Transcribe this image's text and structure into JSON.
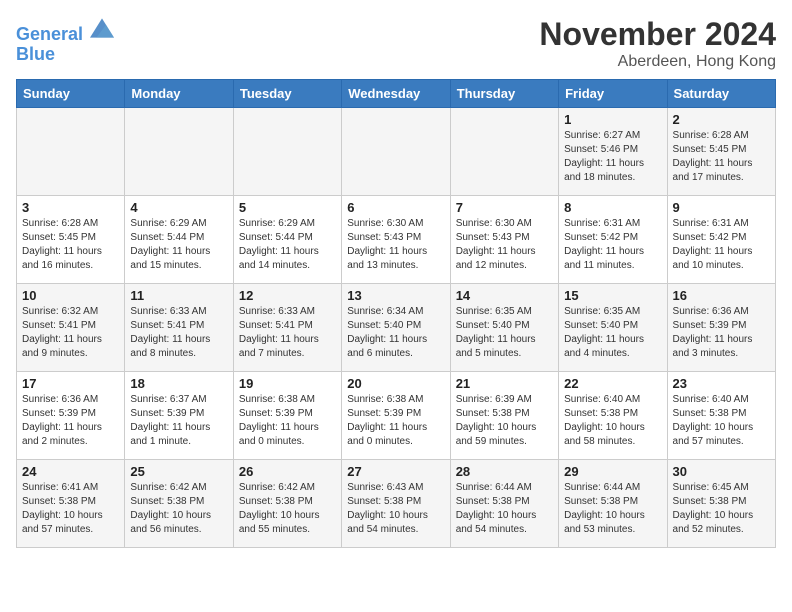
{
  "header": {
    "logo_line1": "General",
    "logo_line2": "Blue",
    "month": "November 2024",
    "location": "Aberdeen, Hong Kong"
  },
  "days_of_week": [
    "Sunday",
    "Monday",
    "Tuesday",
    "Wednesday",
    "Thursday",
    "Friday",
    "Saturday"
  ],
  "weeks": [
    [
      {
        "day": "",
        "info": ""
      },
      {
        "day": "",
        "info": ""
      },
      {
        "day": "",
        "info": ""
      },
      {
        "day": "",
        "info": ""
      },
      {
        "day": "",
        "info": ""
      },
      {
        "day": "1",
        "info": "Sunrise: 6:27 AM\nSunset: 5:46 PM\nDaylight: 11 hours\nand 18 minutes."
      },
      {
        "day": "2",
        "info": "Sunrise: 6:28 AM\nSunset: 5:45 PM\nDaylight: 11 hours\nand 17 minutes."
      }
    ],
    [
      {
        "day": "3",
        "info": "Sunrise: 6:28 AM\nSunset: 5:45 PM\nDaylight: 11 hours\nand 16 minutes."
      },
      {
        "day": "4",
        "info": "Sunrise: 6:29 AM\nSunset: 5:44 PM\nDaylight: 11 hours\nand 15 minutes."
      },
      {
        "day": "5",
        "info": "Sunrise: 6:29 AM\nSunset: 5:44 PM\nDaylight: 11 hours\nand 14 minutes."
      },
      {
        "day": "6",
        "info": "Sunrise: 6:30 AM\nSunset: 5:43 PM\nDaylight: 11 hours\nand 13 minutes."
      },
      {
        "day": "7",
        "info": "Sunrise: 6:30 AM\nSunset: 5:43 PM\nDaylight: 11 hours\nand 12 minutes."
      },
      {
        "day": "8",
        "info": "Sunrise: 6:31 AM\nSunset: 5:42 PM\nDaylight: 11 hours\nand 11 minutes."
      },
      {
        "day": "9",
        "info": "Sunrise: 6:31 AM\nSunset: 5:42 PM\nDaylight: 11 hours\nand 10 minutes."
      }
    ],
    [
      {
        "day": "10",
        "info": "Sunrise: 6:32 AM\nSunset: 5:41 PM\nDaylight: 11 hours\nand 9 minutes."
      },
      {
        "day": "11",
        "info": "Sunrise: 6:33 AM\nSunset: 5:41 PM\nDaylight: 11 hours\nand 8 minutes."
      },
      {
        "day": "12",
        "info": "Sunrise: 6:33 AM\nSunset: 5:41 PM\nDaylight: 11 hours\nand 7 minutes."
      },
      {
        "day": "13",
        "info": "Sunrise: 6:34 AM\nSunset: 5:40 PM\nDaylight: 11 hours\nand 6 minutes."
      },
      {
        "day": "14",
        "info": "Sunrise: 6:35 AM\nSunset: 5:40 PM\nDaylight: 11 hours\nand 5 minutes."
      },
      {
        "day": "15",
        "info": "Sunrise: 6:35 AM\nSunset: 5:40 PM\nDaylight: 11 hours\nand 4 minutes."
      },
      {
        "day": "16",
        "info": "Sunrise: 6:36 AM\nSunset: 5:39 PM\nDaylight: 11 hours\nand 3 minutes."
      }
    ],
    [
      {
        "day": "17",
        "info": "Sunrise: 6:36 AM\nSunset: 5:39 PM\nDaylight: 11 hours\nand 2 minutes."
      },
      {
        "day": "18",
        "info": "Sunrise: 6:37 AM\nSunset: 5:39 PM\nDaylight: 11 hours\nand 1 minute."
      },
      {
        "day": "19",
        "info": "Sunrise: 6:38 AM\nSunset: 5:39 PM\nDaylight: 11 hours\nand 0 minutes."
      },
      {
        "day": "20",
        "info": "Sunrise: 6:38 AM\nSunset: 5:39 PM\nDaylight: 11 hours\nand 0 minutes."
      },
      {
        "day": "21",
        "info": "Sunrise: 6:39 AM\nSunset: 5:38 PM\nDaylight: 10 hours\nand 59 minutes."
      },
      {
        "day": "22",
        "info": "Sunrise: 6:40 AM\nSunset: 5:38 PM\nDaylight: 10 hours\nand 58 minutes."
      },
      {
        "day": "23",
        "info": "Sunrise: 6:40 AM\nSunset: 5:38 PM\nDaylight: 10 hours\nand 57 minutes."
      }
    ],
    [
      {
        "day": "24",
        "info": "Sunrise: 6:41 AM\nSunset: 5:38 PM\nDaylight: 10 hours\nand 57 minutes."
      },
      {
        "day": "25",
        "info": "Sunrise: 6:42 AM\nSunset: 5:38 PM\nDaylight: 10 hours\nand 56 minutes."
      },
      {
        "day": "26",
        "info": "Sunrise: 6:42 AM\nSunset: 5:38 PM\nDaylight: 10 hours\nand 55 minutes."
      },
      {
        "day": "27",
        "info": "Sunrise: 6:43 AM\nSunset: 5:38 PM\nDaylight: 10 hours\nand 54 minutes."
      },
      {
        "day": "28",
        "info": "Sunrise: 6:44 AM\nSunset: 5:38 PM\nDaylight: 10 hours\nand 54 minutes."
      },
      {
        "day": "29",
        "info": "Sunrise: 6:44 AM\nSunset: 5:38 PM\nDaylight: 10 hours\nand 53 minutes."
      },
      {
        "day": "30",
        "info": "Sunrise: 6:45 AM\nSunset: 5:38 PM\nDaylight: 10 hours\nand 52 minutes."
      }
    ]
  ]
}
